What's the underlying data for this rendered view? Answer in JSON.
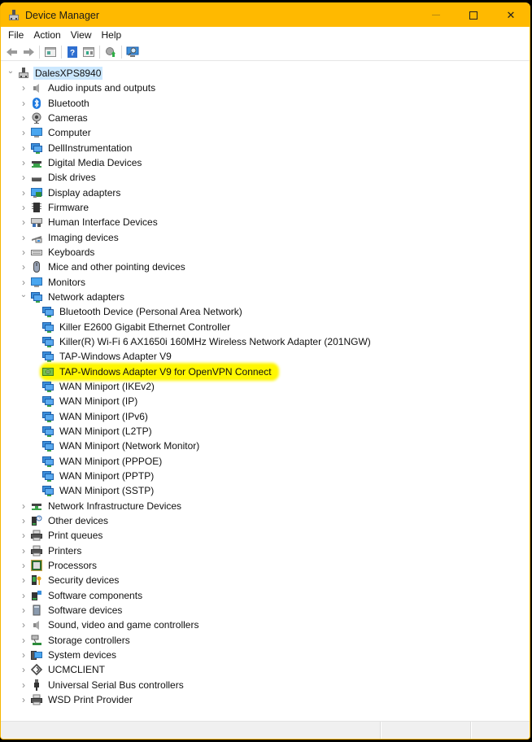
{
  "window": {
    "title": "Device Manager",
    "accent_color": "#ffb900",
    "controls": {
      "minimize": "minimize",
      "maximize": "maximize",
      "close": "✕"
    }
  },
  "menu": [
    "File",
    "Action",
    "View",
    "Help"
  ],
  "toolbar": [
    {
      "name": "back-button",
      "icon": "back-arrow-icon"
    },
    {
      "name": "forward-button",
      "icon": "forward-arrow-icon"
    },
    {
      "sep": true
    },
    {
      "name": "show-hide-console-tree-button",
      "icon": "console-tree-icon"
    },
    {
      "sep": true
    },
    {
      "name": "help-button",
      "icon": "help-icon"
    },
    {
      "name": "show-action-pane-button",
      "icon": "action-pane-icon"
    },
    {
      "sep": true
    },
    {
      "name": "update-driver-button",
      "icon": "update-driver-icon"
    },
    {
      "sep": true
    },
    {
      "name": "scan-hardware-button",
      "icon": "scan-hardware-icon"
    }
  ],
  "tree": {
    "root": {
      "label": "DalesXPS8940",
      "icon": "computer-root-icon",
      "expanded": true,
      "selected": true
    },
    "categories": [
      {
        "label": "Audio inputs and outputs",
        "icon": "speaker-icon"
      },
      {
        "label": "Bluetooth",
        "icon": "bluetooth-icon"
      },
      {
        "label": "Cameras",
        "icon": "camera-icon"
      },
      {
        "label": "Computer",
        "icon": "computer-icon"
      },
      {
        "label": "DellInstrumentation",
        "icon": "network-monitor-icon"
      },
      {
        "label": "Digital Media Devices",
        "icon": "media-device-icon"
      },
      {
        "label": "Disk drives",
        "icon": "disk-drive-icon"
      },
      {
        "label": "Display adapters",
        "icon": "display-adapter-icon"
      },
      {
        "label": "Firmware",
        "icon": "firmware-chip-icon"
      },
      {
        "label": "Human Interface Devices",
        "icon": "hid-icon"
      },
      {
        "label": "Imaging devices",
        "icon": "scanner-icon"
      },
      {
        "label": "Keyboards",
        "icon": "keyboard-icon"
      },
      {
        "label": "Mice and other pointing devices",
        "icon": "mouse-icon"
      },
      {
        "label": "Monitors",
        "icon": "monitor-icon"
      },
      {
        "label": "Network adapters",
        "icon": "network-adapter-icon",
        "expanded": true,
        "children": [
          {
            "label": "Bluetooth Device (Personal Area Network)"
          },
          {
            "label": "Killer E2600 Gigabit Ethernet Controller"
          },
          {
            "label": "Killer(R) Wi-Fi 6 AX1650i 160MHz Wireless Network Adapter (201NGW)"
          },
          {
            "label": "TAP-Windows Adapter V9"
          },
          {
            "label": "TAP-Windows Adapter V9 for OpenVPN Connect",
            "highlighted": true,
            "highlight_color": "#fff700"
          },
          {
            "label": "WAN Miniport (IKEv2)"
          },
          {
            "label": "WAN Miniport (IP)"
          },
          {
            "label": "WAN Miniport (IPv6)"
          },
          {
            "label": "WAN Miniport (L2TP)"
          },
          {
            "label": "WAN Miniport (Network Monitor)"
          },
          {
            "label": "WAN Miniport (PPPOE)"
          },
          {
            "label": "WAN Miniport (PPTP)"
          },
          {
            "label": "WAN Miniport (SSTP)"
          }
        ]
      },
      {
        "label": "Network Infrastructure Devices",
        "icon": "network-infrastructure-icon"
      },
      {
        "label": "Other devices",
        "icon": "other-devices-icon"
      },
      {
        "label": "Print queues",
        "icon": "printer-icon"
      },
      {
        "label": "Printers",
        "icon": "printer-icon"
      },
      {
        "label": "Processors",
        "icon": "processor-icon"
      },
      {
        "label": "Security devices",
        "icon": "security-device-icon"
      },
      {
        "label": "Software components",
        "icon": "software-component-icon"
      },
      {
        "label": "Software devices",
        "icon": "software-device-icon"
      },
      {
        "label": "Sound, video and game controllers",
        "icon": "speaker-icon"
      },
      {
        "label": "Storage controllers",
        "icon": "storage-controller-icon"
      },
      {
        "label": "System devices",
        "icon": "system-devices-icon"
      },
      {
        "label": "UCMCLIENT",
        "icon": "ucm-client-icon"
      },
      {
        "label": "Universal Serial Bus controllers",
        "icon": "usb-icon"
      },
      {
        "label": "WSD Print Provider",
        "icon": "printer-icon"
      }
    ]
  }
}
